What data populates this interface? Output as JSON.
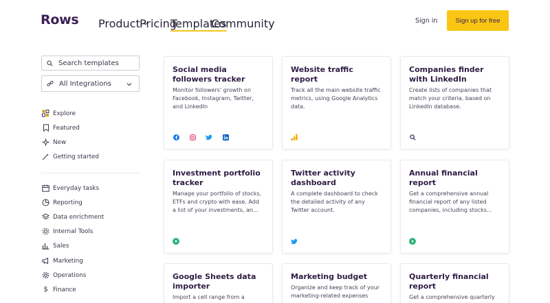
{
  "header": {
    "logo": "Rows",
    "nav": [
      {
        "label": "Product"
      },
      {
        "label": "Pricing"
      },
      {
        "label": "Templates"
      },
      {
        "label": "Community"
      }
    ],
    "signin": "Sign in",
    "signup": "Sign up for free"
  },
  "sidebar": {
    "search_placeholder": "Search templates",
    "integrations": "All Integrations",
    "primary": [
      {
        "label": "Explore",
        "icon": "grid-icon"
      },
      {
        "label": "Featured",
        "icon": "bookmark-icon"
      },
      {
        "label": "New",
        "icon": "sparkle-icon"
      },
      {
        "label": "Getting started",
        "icon": "wand-icon"
      }
    ],
    "categories": [
      {
        "label": "Everyday tasks",
        "icon": "calendar-icon"
      },
      {
        "label": "Reporting",
        "icon": "pie-icon"
      },
      {
        "label": "Data enrichment",
        "icon": "layers-icon"
      },
      {
        "label": "Internal Tools",
        "icon": "gear-icon"
      },
      {
        "label": "Sales",
        "icon": "bar-chart-icon"
      },
      {
        "label": "Marketing",
        "icon": "megaphone-icon"
      },
      {
        "label": "Operations",
        "icon": "cog-icon"
      },
      {
        "label": "Finance",
        "icon": "dollar-icon"
      }
    ]
  },
  "cards": [
    {
      "title": "Social media followers tracker",
      "desc": "Monitor followers' growth on Facebook, Instagram, Twitter, and LinkedIn",
      "icons": [
        "facebook-icon",
        "instagram-icon",
        "twitter-icon",
        "linkedin-icon"
      ]
    },
    {
      "title": "Website traffic report",
      "desc": "Track all the main website traffic metrics, using Google Analytics data.",
      "icons": [
        "google-analytics-icon"
      ]
    },
    {
      "title": "Companies finder with LinkedIn",
      "desc": "Create lists of companies that match your criteria, based on LinkedIn database.",
      "icons": [
        "search-icon"
      ]
    },
    {
      "title": "Investment portfolio tracker",
      "desc": "Manage your portfolio of stocks, ETFs and crypto with ease. Add a list of your investments, an...",
      "icons": [
        "play-icon"
      ]
    },
    {
      "title": "Twitter activity dashboard",
      "desc": "A complete dashboard to check the detailed activity of any Twitter account.",
      "icons": [
        "twitter-icon"
      ]
    },
    {
      "title": "Annual financial report",
      "desc": "Get a comprehensive annual financial report of any listed companies, including stocks...",
      "icons": [
        "play-icon"
      ]
    },
    {
      "title": "Google Sheets data importer",
      "desc": "Import a cell range from a",
      "icons": []
    },
    {
      "title": "Marketing budget",
      "desc": "Organize and keep track of your marketing-related expenses",
      "icons": []
    },
    {
      "title": "Quarterly financial report",
      "desc": "Get a comprehensive quarterly",
      "icons": []
    }
  ],
  "colors": {
    "brand": "#3b1f55",
    "accent": "#f8c613"
  }
}
